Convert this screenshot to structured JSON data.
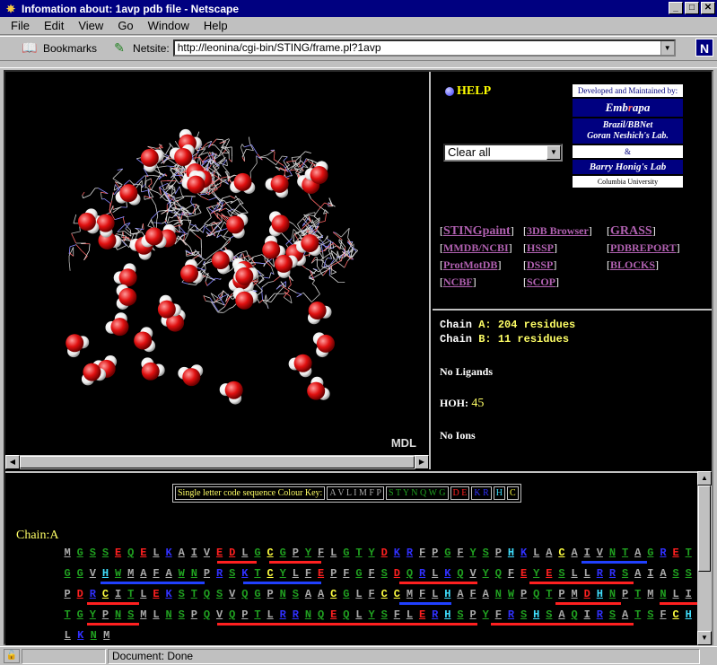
{
  "window": {
    "title": "Infomation about: 1avp pdb file - Netscape",
    "buttons": [
      "_",
      "□",
      "✕"
    ]
  },
  "menu": [
    "File",
    "Edit",
    "View",
    "Go",
    "Window",
    "Help"
  ],
  "toolbar": {
    "bookmarks_label": "Bookmarks",
    "netsite_label": "Netsite:",
    "url": "http://leonina/cgi-bin/STING/frame.pl?1avp",
    "logo": "N"
  },
  "viewer": {
    "mdl_label": "MDL"
  },
  "right": {
    "help": "HELP",
    "select_value": "Clear all",
    "credits": {
      "developed": "Developed and Maintained by:",
      "embrapa_pre": "Emb",
      "embrapa_mid": "r",
      "embrapa_post": "apa",
      "bbnet1": "Brazil/BBNet",
      "bbnet2": "Goran Neshich's Lab.",
      "amp": "&",
      "honig": "Barry Honig's Lab",
      "columbia": "Columbia University"
    },
    "links": [
      [
        "STINGpaint",
        "3DB Browser",
        "GRASS"
      ],
      [
        "MMDB/NCBI",
        "HSSP",
        "PDBREPORT"
      ],
      [
        "ProtMotDB",
        "DSSP",
        "BLOCKS"
      ],
      [
        "NCBF",
        "SCOP",
        ""
      ]
    ],
    "chain_a": {
      "label": "Chain",
      "id": "A",
      "text": ": 204 residues"
    },
    "chain_b": {
      "label": "Chain",
      "id": "B",
      "text": ": 11 residues"
    },
    "ligands": "No Ligands",
    "hoh_label": "HOH:",
    "hoh_value": "45",
    "ions": "No Ions"
  },
  "key": {
    "title": "Single letter code sequence Colour Key:",
    "groups": [
      {
        "text": "A V L I M F P",
        "color": "#aaaaaa"
      },
      {
        "text": "S T Y N Q W G",
        "color": "#20a020"
      },
      {
        "text": "D E",
        "color": "#ff2020"
      },
      {
        "text": "K R",
        "color": "#3030ff"
      },
      {
        "text": "H",
        "color": "#40e0ff"
      },
      {
        "text": "C",
        "color": "#ffff40"
      }
    ]
  },
  "sequence": {
    "chain_label": "Chain:A",
    "rows": [
      "MGSSEQELKAIVEDLGCGPYFLGTYDKRFPGFYSPHKLACAIVNTAGRET",
      "GGVHWMAFAWNPRSKTCYLFEPFGFSDQRLKQVYQFEYESLLRRSAIASS",
      "PDRCITLEKSTQSVQGPNSAACGLFCCMFLHAFANWPQTPMDHNPTMNLI",
      "TGYPNSMLNSPQVQPTLRRNQEQLYSFLERHSPYFRSHSAQIRSATSFCH",
      "LKNM"
    ]
  },
  "status": {
    "text": "Document: Done"
  }
}
